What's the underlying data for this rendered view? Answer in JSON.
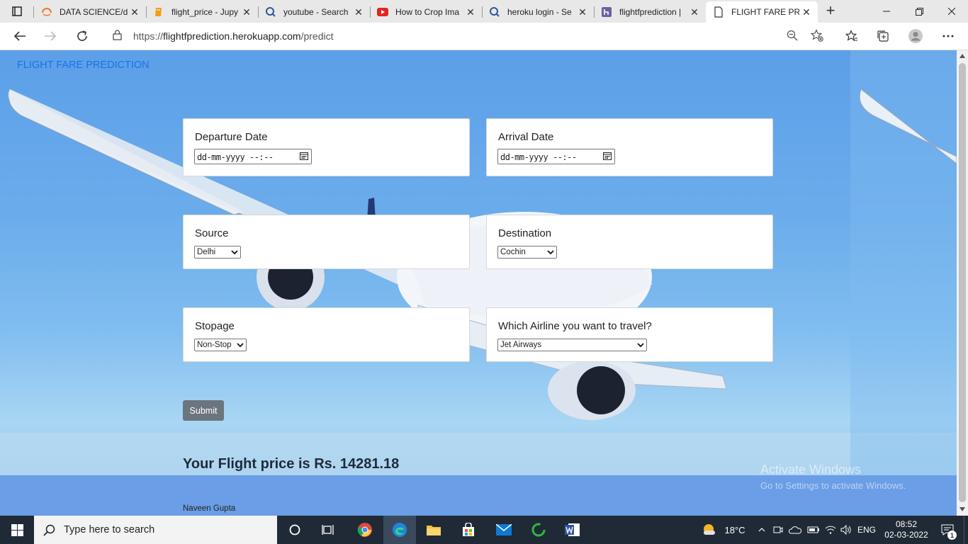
{
  "browser": {
    "tabs": [
      {
        "title": "DATA SCIENCE/d",
        "icon": "jupyter-icon"
      },
      {
        "title": "flight_price - Jupy",
        "icon": "notebook-icon"
      },
      {
        "title": "youtube - Search",
        "icon": "search-icon"
      },
      {
        "title": "How to Crop Ima",
        "icon": "youtube-icon"
      },
      {
        "title": "heroku login - Se",
        "icon": "search-icon"
      },
      {
        "title": "flightfprediction |",
        "icon": "heroku-icon"
      },
      {
        "title": "FLIGHT FARE PRE",
        "icon": "page-icon",
        "active": true
      }
    ],
    "url_prefix": "https://",
    "url_host": "flightfprediction.herokuapp.com",
    "url_path": "/predict"
  },
  "page": {
    "brand": "FLIGHT FARE PREDICTION",
    "departure": {
      "label": "Departure Date",
      "placeholder": "dd-mm-yyyy --:--"
    },
    "arrival": {
      "label": "Arrival Date",
      "placeholder": "dd-mm-yyyy --:--"
    },
    "source": {
      "label": "Source",
      "value": "Delhi"
    },
    "destination": {
      "label": "Destination",
      "value": "Cochin"
    },
    "stopage": {
      "label": "Stopage",
      "value": "Non-Stop"
    },
    "airline": {
      "label": "Which Airline you want to travel?",
      "value": "Jet Airways"
    },
    "submit_label": "Submit",
    "result_text": "Your Flight price is Rs. 14281.18",
    "footer": "Naveen Gupta"
  },
  "watermark": {
    "line1": "Activate Windows",
    "line2": "Go to Settings to activate Windows."
  },
  "taskbar": {
    "search_placeholder": "Type here to search",
    "weather": "18°C",
    "language": "ENG",
    "time": "08:52",
    "date": "02-03-2022",
    "notification_count": "1"
  },
  "colors": {
    "brand_link": "#1a73e8",
    "submit_bg": "#6c757d",
    "taskbar_bg": "#1f2a36"
  }
}
